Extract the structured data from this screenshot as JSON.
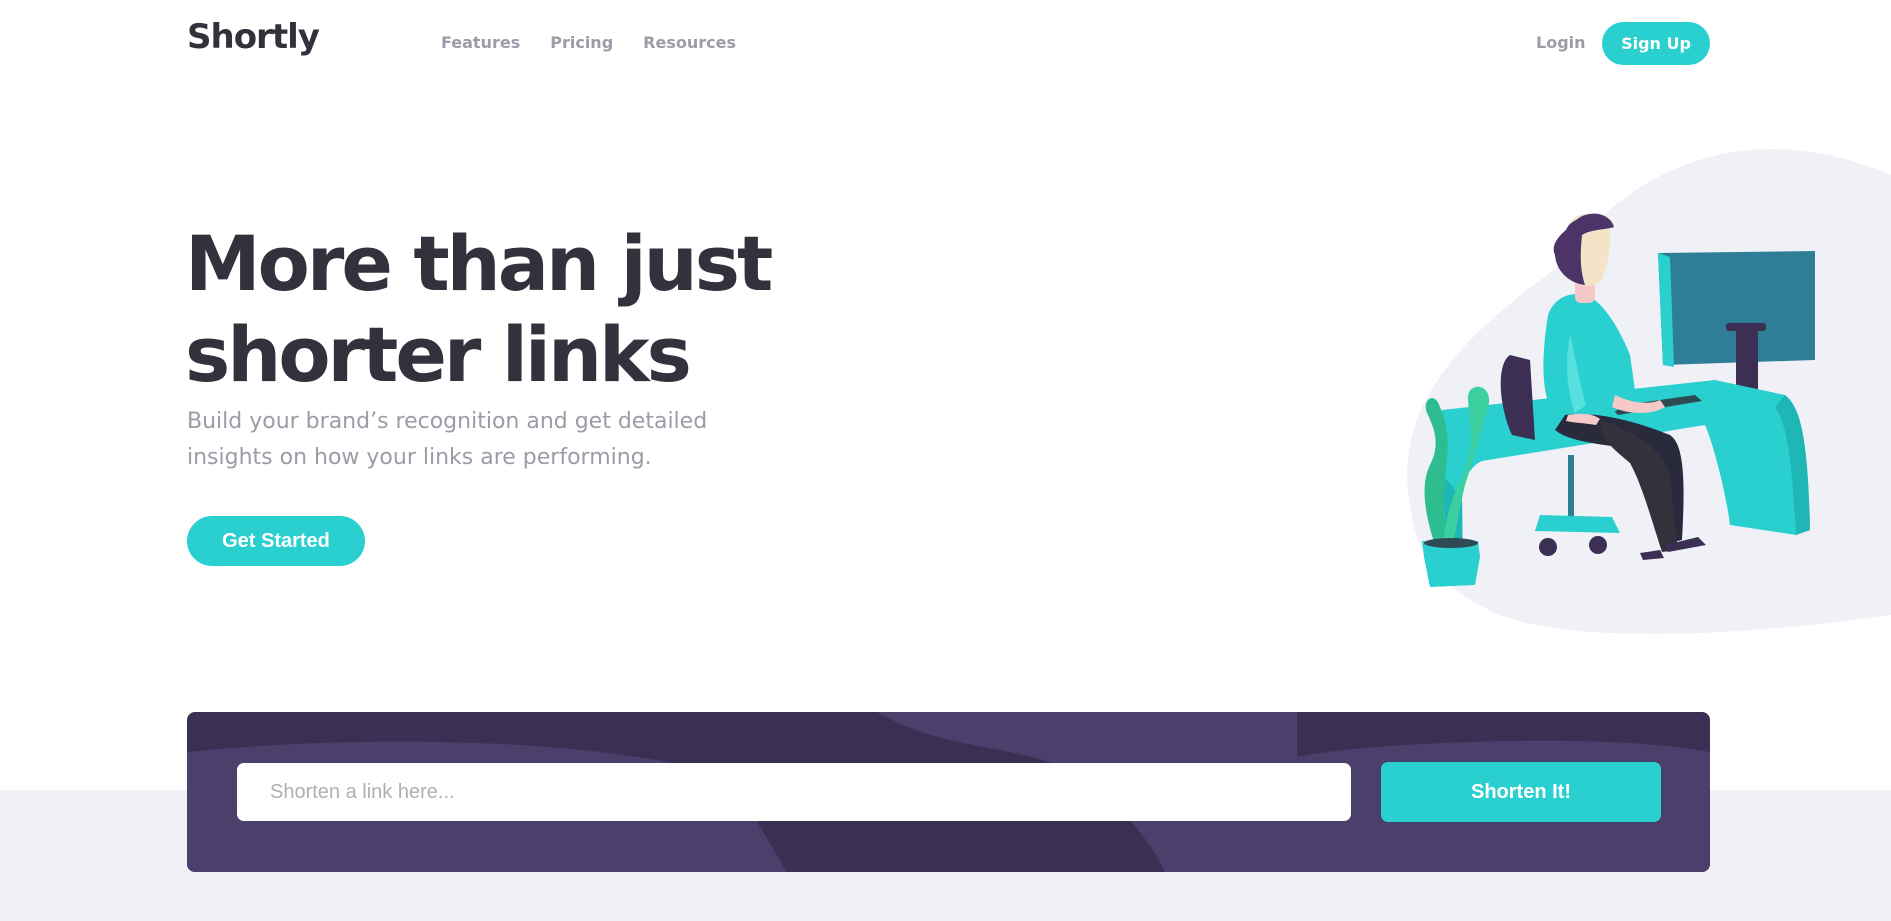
{
  "brand": {
    "logo": "Shortly"
  },
  "nav": {
    "items": [
      "Features",
      "Pricing",
      "Resources"
    ]
  },
  "auth": {
    "login": "Login",
    "signup": "Sign Up"
  },
  "hero": {
    "title_line1": "More than just",
    "title_line2": "shorter links",
    "subtitle_line1": "Build your brand’s recognition and get detailed",
    "subtitle_line2": "insights on how your links are performing.",
    "cta": "Get Started"
  },
  "shorten": {
    "placeholder": "Shorten a link here...",
    "value": "",
    "button": "Shorten It!"
  },
  "icons": {
    "illustration": "person-working-illustration"
  },
  "colors": {
    "cyan": "#2acfcf",
    "dark_violet": "#3b3054",
    "very_dark_violet": "#34313d",
    "gray": "#9e9aa7",
    "light_gray_bg": "#eff1f7"
  }
}
